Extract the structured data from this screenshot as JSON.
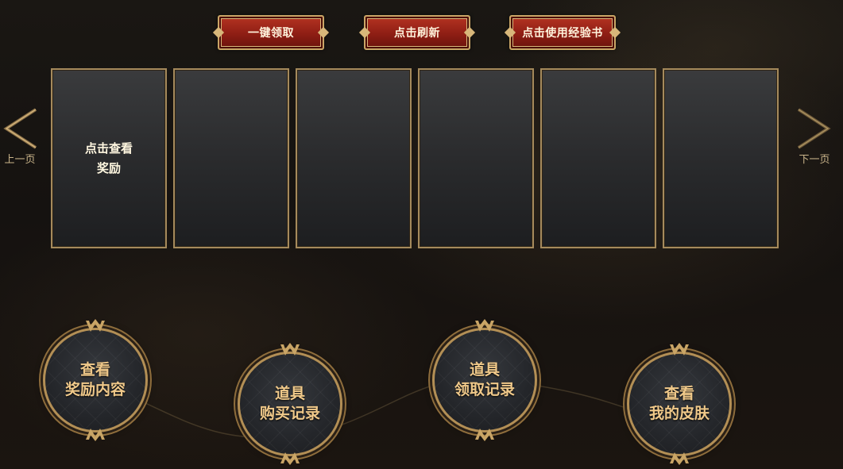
{
  "top_buttons": [
    {
      "label": "一键领取"
    },
    {
      "label": "点击刷新"
    },
    {
      "label": "点击使用经验书"
    }
  ],
  "nav": {
    "prev_label": "上一页",
    "next_label": "下一页"
  },
  "cards": [
    {
      "text": "点击查看\n奖励"
    },
    {
      "text": ""
    },
    {
      "text": ""
    },
    {
      "text": ""
    },
    {
      "text": ""
    },
    {
      "text": ""
    }
  ],
  "menu": [
    {
      "label": "查看\n奖励内容"
    },
    {
      "label": "道具\n购买记录"
    },
    {
      "label": "道具\n领取记录"
    },
    {
      "label": "查看\n我的皮肤"
    }
  ],
  "colors": {
    "button_red": "#8e1e14",
    "gold_border": "#b38f55",
    "menu_text": "#f0c98a"
  }
}
